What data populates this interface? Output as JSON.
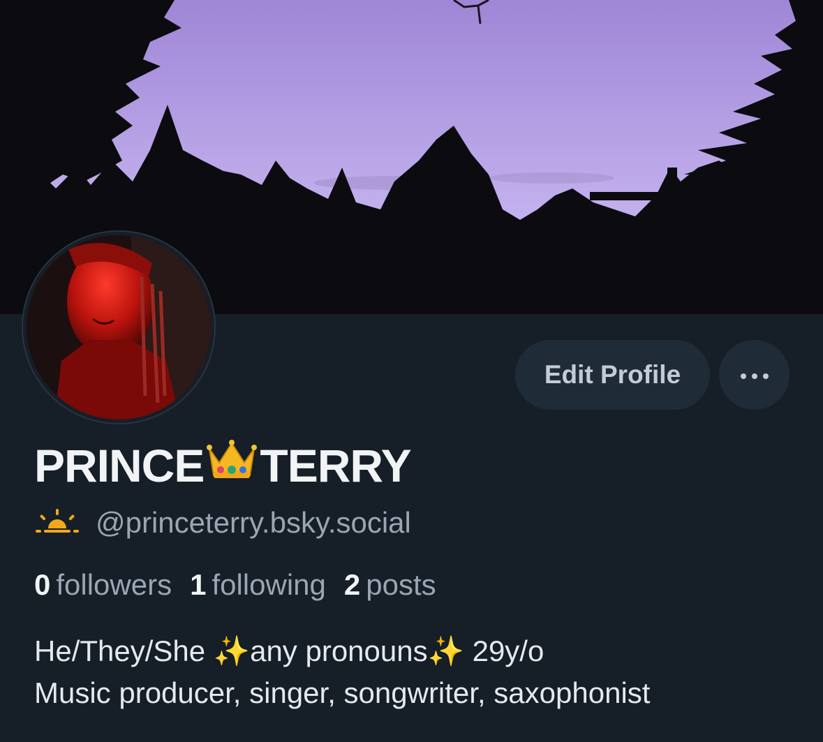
{
  "colors": {
    "background": "#161e27",
    "button_bg": "#1f2b36",
    "primary_text": "#f1f3f5",
    "secondary_text": "#9aa6b3",
    "sky": "#b7a2e6"
  },
  "profile": {
    "display_name_first": "PRINCE",
    "display_name_emoji": "crown-emoji",
    "display_name_last": "TERRY",
    "handle_icon": "sunrise-icon",
    "handle": "@princeterry.bsky.social",
    "stats": {
      "followers_count": "0",
      "followers_label": "followers",
      "following_count": "1",
      "following_label": "following",
      "posts_count": "2",
      "posts_label": "posts"
    },
    "bio_line1": "He/They/She ✨any pronouns✨ 29y/o",
    "bio_line2": "Music producer, singer, songwriter, saxophonist"
  },
  "actions": {
    "edit_profile_label": "Edit Profile",
    "more_icon": "more-horizontal-icon"
  }
}
